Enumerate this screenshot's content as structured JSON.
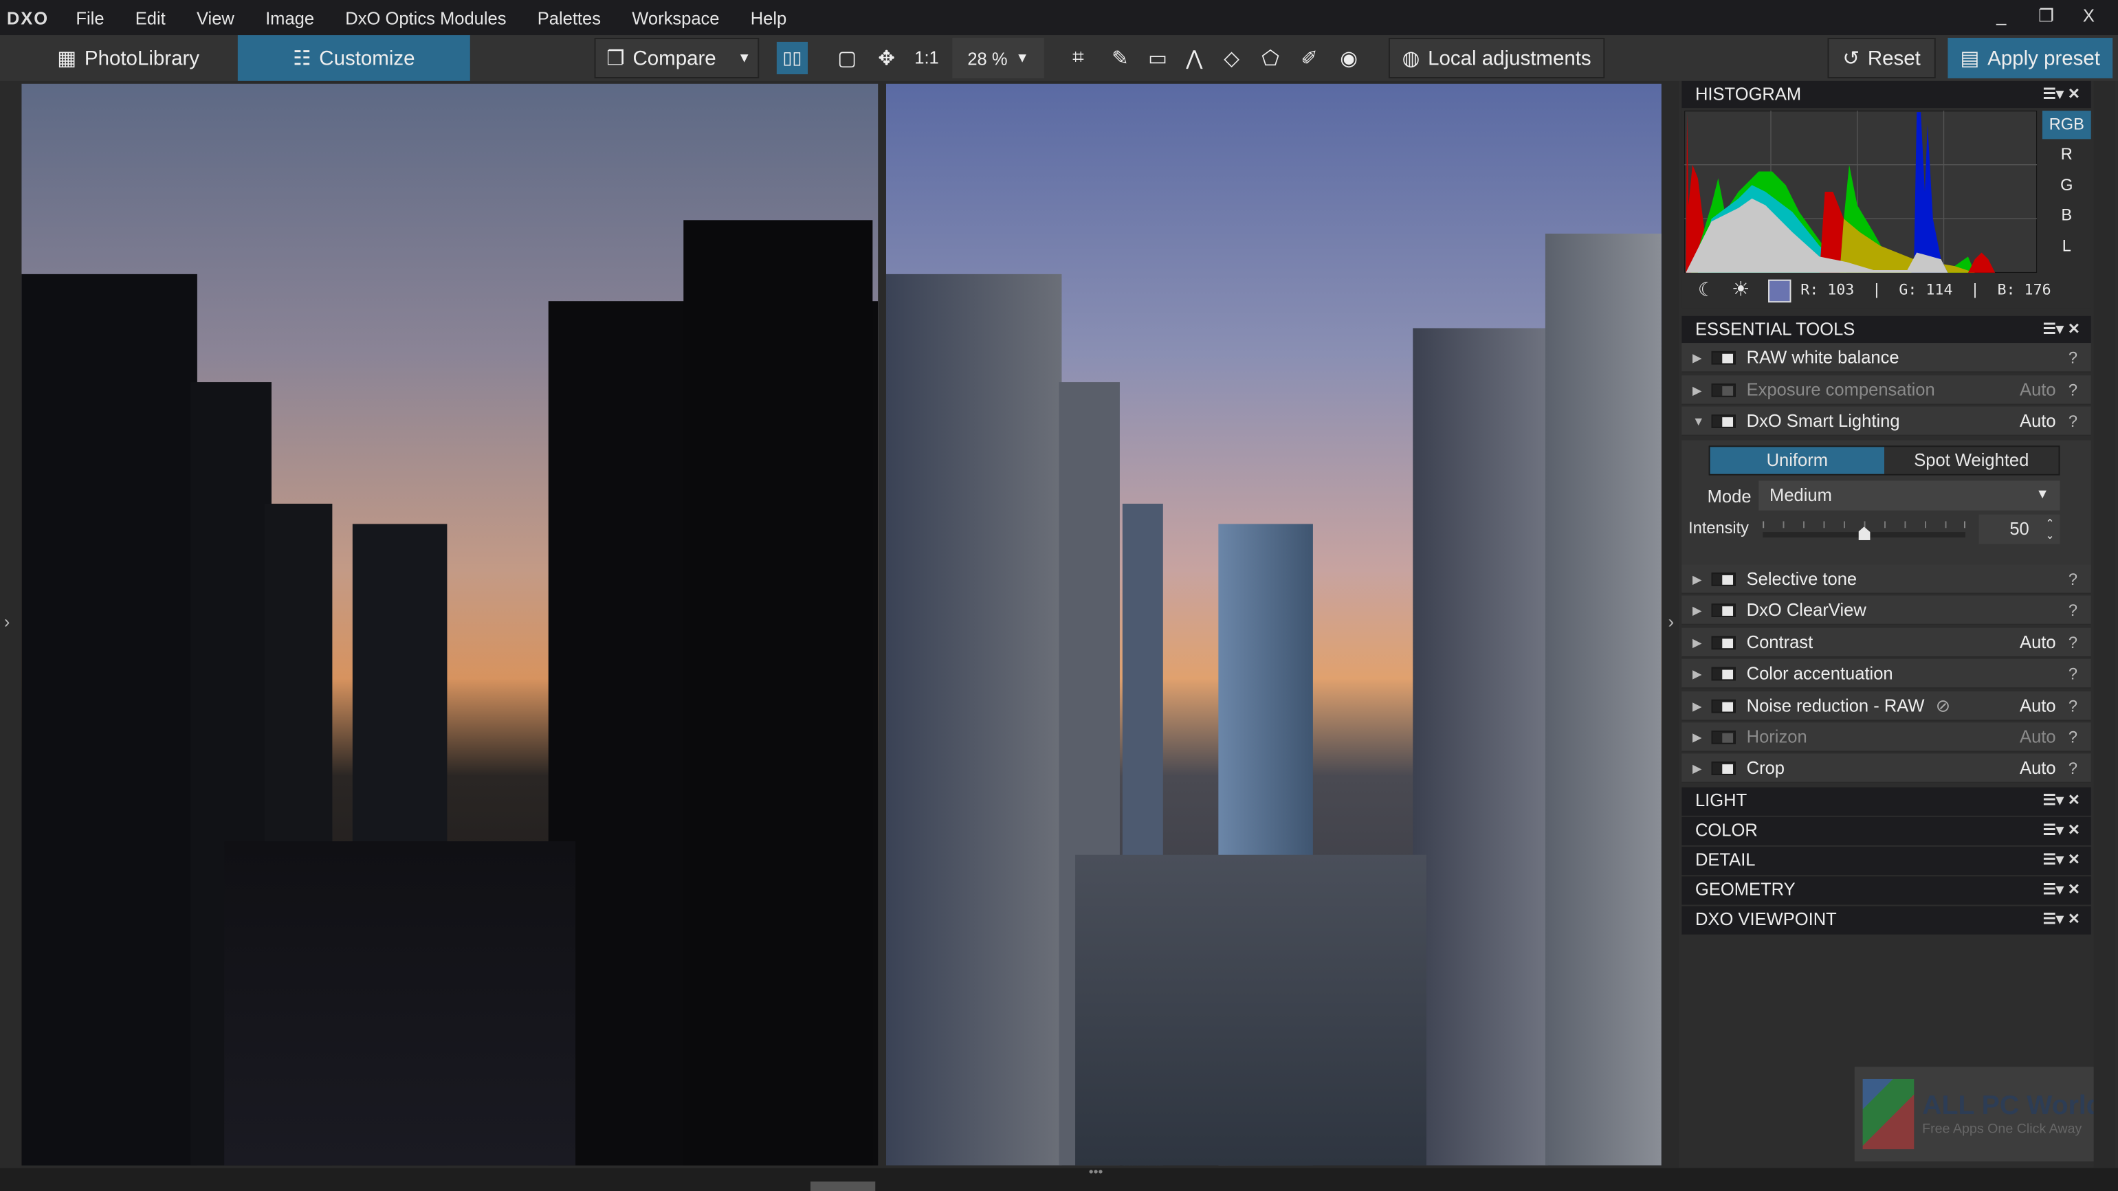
{
  "app": {
    "logo": "DXO"
  },
  "menu": [
    "File",
    "Edit",
    "View",
    "Image",
    "DxO Optics Modules",
    "Palettes",
    "Workspace",
    "Help"
  ],
  "window": {
    "minimize": "_",
    "restore": "❐",
    "close": "X"
  },
  "toolbar": {
    "photolibrary": "PhotoLibrary",
    "customize": "Customize",
    "compare": "Compare",
    "ratio": "1:1",
    "zoom": "28 %",
    "local_adjustments": "Local adjustments",
    "reset": "Reset",
    "apply_preset": "Apply preset"
  },
  "histogram": {
    "title": "HISTOGRAM",
    "channels": [
      "RGB",
      "R",
      "G",
      "B",
      "L"
    ],
    "active_channel": "RGB",
    "readout": "R: 103  |  G: 114  |  B: 176",
    "swatch_color": "#6a74b0"
  },
  "essential": {
    "title": "ESSENTIAL TOOLS",
    "rows_top": [
      {
        "label": "RAW white balance",
        "auto": "",
        "enabled": true
      },
      {
        "label": "Exposure compensation",
        "auto": "Auto",
        "enabled": false
      },
      {
        "label": "DxO Smart Lighting",
        "auto": "Auto",
        "enabled": true
      }
    ],
    "smart_lighting": {
      "uniform": "Uniform",
      "spot": "Spot Weighted",
      "mode_label": "Mode",
      "mode_value": "Medium",
      "intensity_label": "Intensity",
      "intensity_value": "50",
      "intensity_fraction": 0.5
    },
    "rows_bottom": [
      {
        "label": "Selective tone",
        "auto": "",
        "enabled": true
      },
      {
        "label": "DxO ClearView",
        "auto": "",
        "enabled": true
      },
      {
        "label": "Contrast",
        "auto": "Auto",
        "enabled": true
      },
      {
        "label": "Color accentuation",
        "auto": "",
        "enabled": true
      },
      {
        "label": "Noise reduction - RAW",
        "auto": "Auto",
        "enabled": true
      },
      {
        "label": "Horizon",
        "auto": "Auto",
        "enabled": false
      },
      {
        "label": "Crop",
        "auto": "Auto",
        "enabled": true
      }
    ],
    "help": "?"
  },
  "palettes": [
    "LIGHT",
    "COLOR",
    "DETAIL",
    "GEOMETRY",
    "DXO VIEWPOINT"
  ],
  "palette_controls": {
    "menu": "☰▾",
    "close": "✕"
  },
  "watermark": {
    "title": "ALL PC World",
    "subtitle": "Free Apps One Click Away"
  },
  "colors": {
    "accent": "#2a6a8e",
    "bg": "#2d2d2d",
    "header": "#1c1c1f"
  }
}
